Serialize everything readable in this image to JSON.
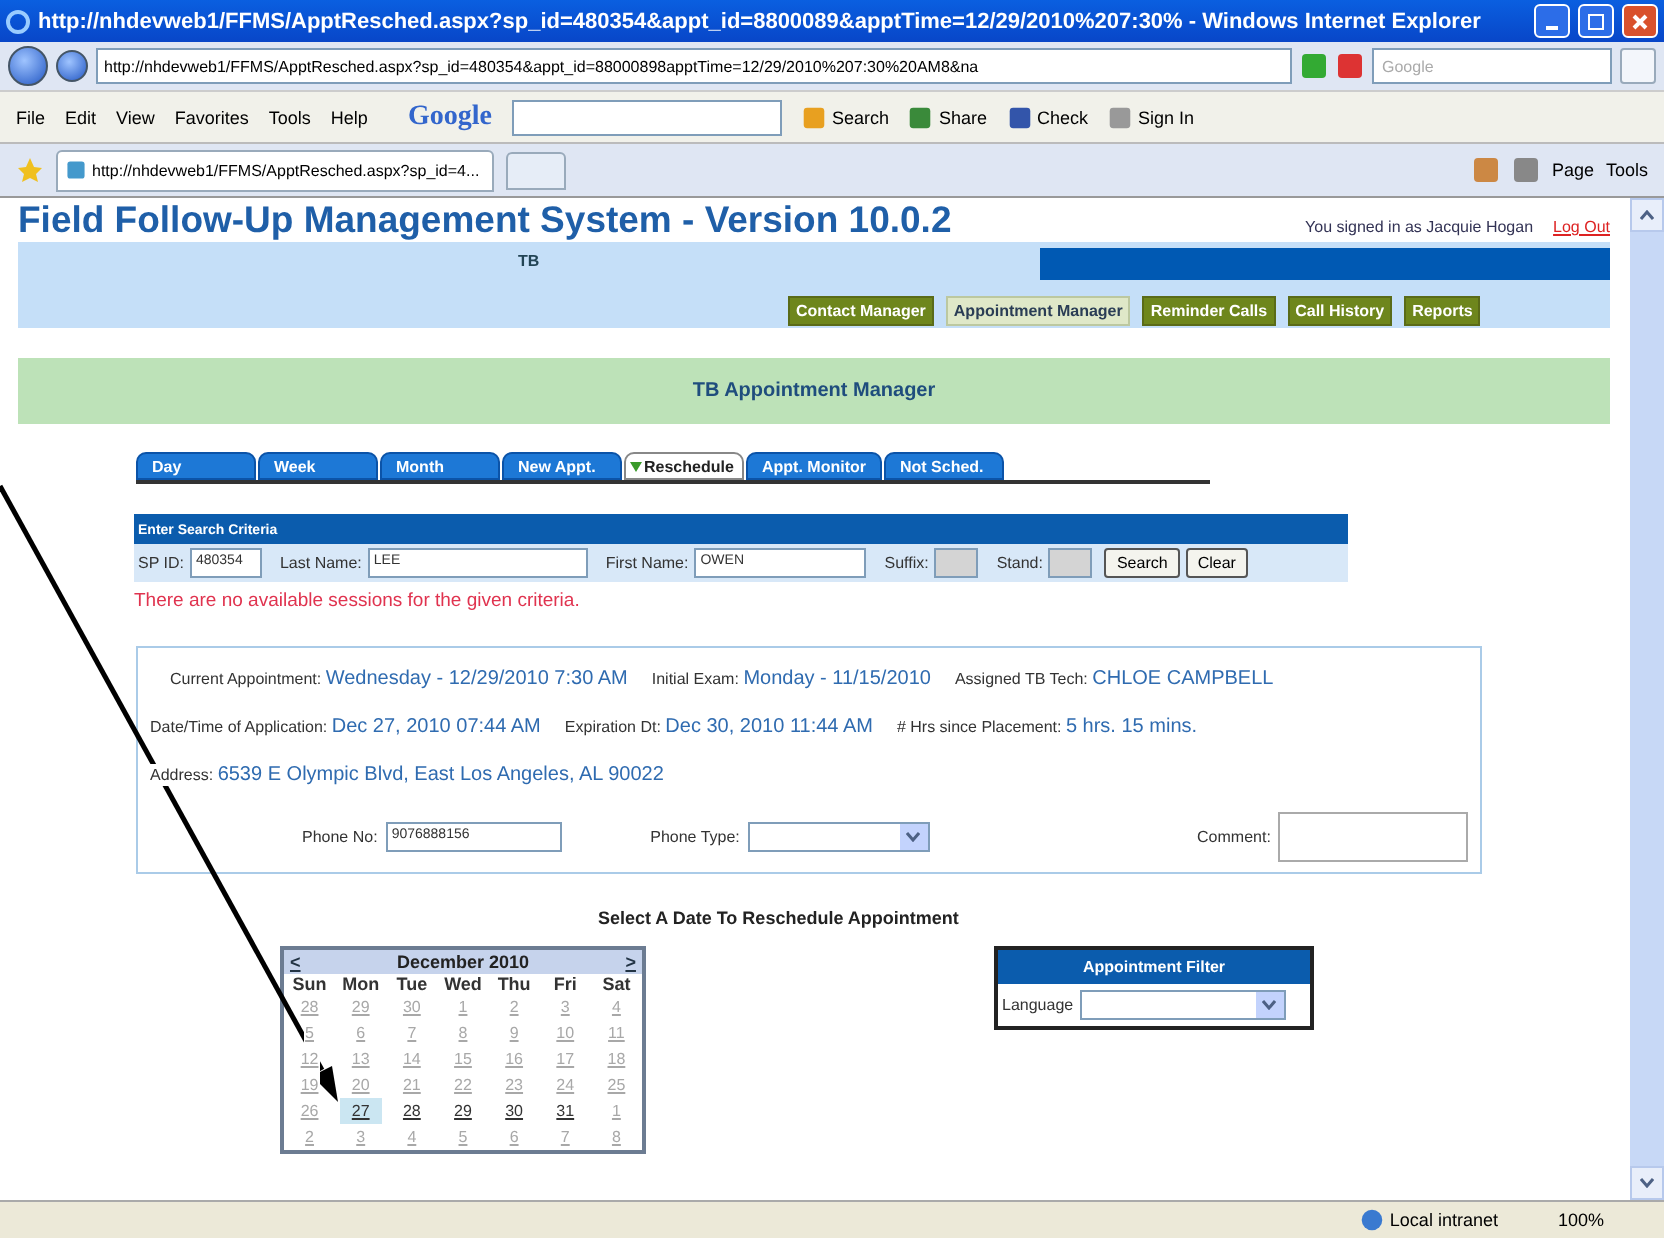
{
  "window": {
    "title": "http://nhdevweb1/FFMS/ApptResched.aspx?sp_id=480354&appt_id=8800089&apptTime=12/29/2010%207:30% - Windows Internet Explorer"
  },
  "browser": {
    "address": "http://nhdevweb1/FFMS/ApptResched.aspx?sp_id=480354&appt_id=88000898apptTime=12/29/2010%207:30%20AM8&na",
    "search_placeholder": "Google",
    "menu": [
      "File",
      "Edit",
      "View",
      "Favorites",
      "Tools",
      "Help"
    ],
    "google_label": "Google",
    "toolbar": [
      "Search",
      "Share",
      "Check",
      "Sign In"
    ],
    "tab": "http://nhdevweb1/FFMS/ApptResched.aspx?sp_id=4...",
    "command_bar": [
      "Page",
      "Tools"
    ]
  },
  "header": {
    "title": "Field Follow-Up Management System - Version 10.0.2",
    "signed_in": "You signed in as Jacquie Hogan",
    "logout": "Log Out",
    "program": "TB"
  },
  "nav": [
    {
      "label": "Contact Manager",
      "selected": false
    },
    {
      "label": "Appointment Manager",
      "selected": true
    },
    {
      "label": "Reminder Calls",
      "selected": false
    },
    {
      "label": "Call History",
      "selected": false
    },
    {
      "label": "Reports",
      "selected": false
    }
  ],
  "page_title": "TB Appointment Manager",
  "tabs": [
    {
      "label": "Day",
      "selected": false
    },
    {
      "label": "Week",
      "selected": false
    },
    {
      "label": "Month",
      "selected": false
    },
    {
      "label": "New Appt.",
      "selected": false
    },
    {
      "label": "Reschedule",
      "selected": true
    },
    {
      "label": "Appt. Monitor",
      "selected": false
    },
    {
      "label": "Not Sched.",
      "selected": false
    }
  ],
  "search": {
    "title": "Enter Search Criteria",
    "fields": [
      {
        "label": "SP ID:",
        "value": "480354",
        "disabled": false
      },
      {
        "label": "Last Name:",
        "value": "LEE",
        "disabled": false
      },
      {
        "label": "First Name:",
        "value": "OWEN",
        "disabled": false
      },
      {
        "label": "Suffix:",
        "disabled": true
      },
      {
        "label": "Stand:",
        "disabled": true
      }
    ],
    "buttons": [
      "Search",
      "Clear"
    ]
  },
  "error": "There are no available sessions for the given criteria.",
  "appointment": {
    "rows": [
      [
        {
          "label": "Current Appointment:",
          "value": "Wednesday - 12/29/2010 7:30 AM"
        },
        {
          "label": "Initial Exam:",
          "value": "Monday - 11/15/2010"
        },
        {
          "label": "Assigned TB Tech:",
          "value": "CHLOE CAMPBELL"
        }
      ],
      [
        {
          "label": "Date/Time of Application:",
          "value": "Dec 27, 2010 07:44 AM"
        },
        {
          "label": "Expiration Dt:",
          "value": "Dec 30, 2010 11:44 AM"
        },
        {
          "label": "# Hrs since Placement:",
          "value": "5 hrs. 15 mins."
        }
      ],
      [
        {
          "label": "Address:",
          "value": "6539 E Olympic Blvd, East Los Angeles, AL 90022"
        }
      ]
    ],
    "phone": {
      "label": "Phone No:",
      "value": "9076888156"
    },
    "phone_type": {
      "label": "Phone Type:"
    },
    "comment": {
      "label": "Comment:"
    }
  },
  "calendar": {
    "title": "Select A Date To Reschedule Appointment",
    "month": "December 2010",
    "prev": "<",
    "next": ">",
    "weekdays": [
      "Sun",
      "Mon",
      "Tue",
      "Wed",
      "Thu",
      "Fri",
      "Sat"
    ],
    "days": [
      {
        "day": "28",
        "disabled": true,
        "selected": false
      },
      {
        "day": "29",
        "disabled": true,
        "selected": false
      },
      {
        "day": "30",
        "disabled": true,
        "selected": false
      },
      {
        "day": "1",
        "disabled": true,
        "selected": false
      },
      {
        "day": "2",
        "disabled": true,
        "selected": false
      },
      {
        "day": "3",
        "disabled": true,
        "selected": false
      },
      {
        "day": "4",
        "disabled": true,
        "selected": false
      },
      {
        "day": "5",
        "disabled": true,
        "selected": false
      },
      {
        "day": "6",
        "disabled": true,
        "selected": false
      },
      {
        "day": "7",
        "disabled": true,
        "selected": false
      },
      {
        "day": "8",
        "disabled": true,
        "selected": false
      },
      {
        "day": "9",
        "disabled": true,
        "selected": false
      },
      {
        "day": "10",
        "disabled": true,
        "selected": false
      },
      {
        "day": "11",
        "disabled": true,
        "selected": false
      },
      {
        "day": "12",
        "disabled": true,
        "selected": false
      },
      {
        "day": "13",
        "disabled": true,
        "selected": false
      },
      {
        "day": "14",
        "disabled": true,
        "selected": false
      },
      {
        "day": "15",
        "disabled": true,
        "selected": false
      },
      {
        "day": "16",
        "disabled": true,
        "selected": false
      },
      {
        "day": "17",
        "disabled": true,
        "selected": false
      },
      {
        "day": "18",
        "disabled": true,
        "selected": false
      },
      {
        "day": "19",
        "disabled": true,
        "selected": false
      },
      {
        "day": "20",
        "disabled": true,
        "selected": false
      },
      {
        "day": "21",
        "disabled": true,
        "selected": false
      },
      {
        "day": "22",
        "disabled": true,
        "selected": false
      },
      {
        "day": "23",
        "disabled": true,
        "selected": false
      },
      {
        "day": "24",
        "disabled": true,
        "selected": false
      },
      {
        "day": "25",
        "disabled": true,
        "selected": false
      },
      {
        "day": "26",
        "disabled": true,
        "selected": false
      },
      {
        "day": "27",
        "disabled": false,
        "selected": true
      },
      {
        "day": "28",
        "disabled": false,
        "selected": false
      },
      {
        "day": "29",
        "disabled": false,
        "selected": false
      },
      {
        "day": "30",
        "disabled": false,
        "selected": false
      },
      {
        "day": "31",
        "disabled": false,
        "selected": false
      },
      {
        "day": "1",
        "disabled": true,
        "selected": false
      },
      {
        "day": "2",
        "disabled": true,
        "selected": false
      },
      {
        "day": "3",
        "disabled": true,
        "selected": false
      },
      {
        "day": "4",
        "disabled": true,
        "selected": false
      },
      {
        "day": "5",
        "disabled": true,
        "selected": false
      },
      {
        "day": "6",
        "disabled": true,
        "selected": false
      },
      {
        "day": "7",
        "disabled": true,
        "selected": false
      },
      {
        "day": "8",
        "disabled": true,
        "selected": false
      }
    ]
  },
  "filter": {
    "title": "Appointment Filter",
    "label": "Language"
  },
  "status_bar": {
    "zone": "Local intranet",
    "zoom": "100%"
  }
}
